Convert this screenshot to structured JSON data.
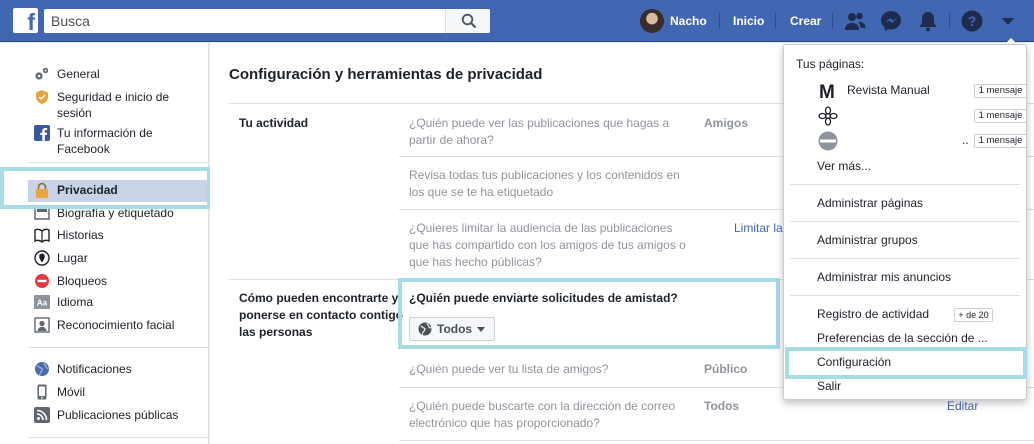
{
  "topbar": {
    "logo": "f",
    "search_placeholder": "Busca",
    "user_name": "Nacho",
    "home_label": "Inicio",
    "create_label": "Crear",
    "icons": [
      "friends-icon",
      "messenger-icon",
      "notifications-icon",
      "help-icon",
      "account-menu-icon"
    ]
  },
  "sidebar": {
    "items": [
      {
        "label": "General",
        "icon": "gear-icon"
      },
      {
        "label": "Seguridad e inicio de sesión",
        "icon": "shield-badge-icon"
      },
      {
        "label": "Tu información de Facebook",
        "icon": "facebook-icon"
      },
      {
        "label": "Privacidad",
        "icon": "lock-icon",
        "active": true
      },
      {
        "label": "Biografía y etiquetado",
        "icon": "timeline-icon"
      },
      {
        "label": "Historias",
        "icon": "book-icon"
      },
      {
        "label": "Lugar",
        "icon": "location-icon"
      },
      {
        "label": "Bloqueos",
        "icon": "block-icon"
      },
      {
        "label": "Idioma",
        "icon": "language-icon"
      },
      {
        "label": "Reconocimiento facial",
        "icon": "face-recognition-icon"
      },
      {
        "label": "Notificaciones",
        "icon": "globe-icon"
      },
      {
        "label": "Móvil",
        "icon": "mobile-icon"
      },
      {
        "label": "Publicaciones públicas",
        "icon": "rss-icon"
      }
    ]
  },
  "main": {
    "title": "Configuración y herramientas de privacidad",
    "sections": [
      {
        "title": "Tu actividad",
        "rows": [
          {
            "question": "¿Quién puede ver las publicaciones que hagas a partir de ahora?",
            "value": "Amigos"
          },
          {
            "question": "Revisa todas tus publicaciones y los contenidos en los que se te ha etiquetado",
            "value": ""
          },
          {
            "question": "¿Quieres limitar la audiencia de las publicaciones que has compartido con los amigos de tus amigos o que has hecho públicas?",
            "value": "",
            "action": "Limitar la"
          }
        ]
      },
      {
        "title": "Cómo pueden encontrarte y ponerse en contacto contigo las personas",
        "rows": [
          {
            "question": "¿Quién puede enviarte solicitudes de amistad?",
            "button": "Todos"
          },
          {
            "question": "¿Quién puede ver tu lista de amigos?",
            "value": "Público"
          },
          {
            "question": "¿Quién puede buscarte con la dirección de correo electrónico que has proporcionado?",
            "value": "Todos",
            "action": "Editar"
          }
        ]
      }
    ]
  },
  "dropdown": {
    "pages_label": "Tus páginas:",
    "pages": [
      {
        "name": "Revista Manual",
        "badge": "1 mensaje",
        "icon": "M"
      },
      {
        "name": "",
        "badge": "1 mensaje",
        "icon": "flower-logo"
      },
      {
        "name": "..",
        "badge": "1 mensaje",
        "icon": "round-logo"
      }
    ],
    "see_more": "Ver más...",
    "manage_pages": "Administrar páginas",
    "manage_groups": "Administrar grupos",
    "manage_ads": "Administrar mis anuncios",
    "activity_log": "Registro de actividad",
    "activity_badge": "+ de 20",
    "news_prefs": "Preferencias de la sección de ...",
    "settings": "Configuración",
    "logout": "Salir"
  },
  "colors": {
    "brand": "#4267b2",
    "highlight": "#a7dbe6",
    "active_row": "#c8d3e8"
  }
}
